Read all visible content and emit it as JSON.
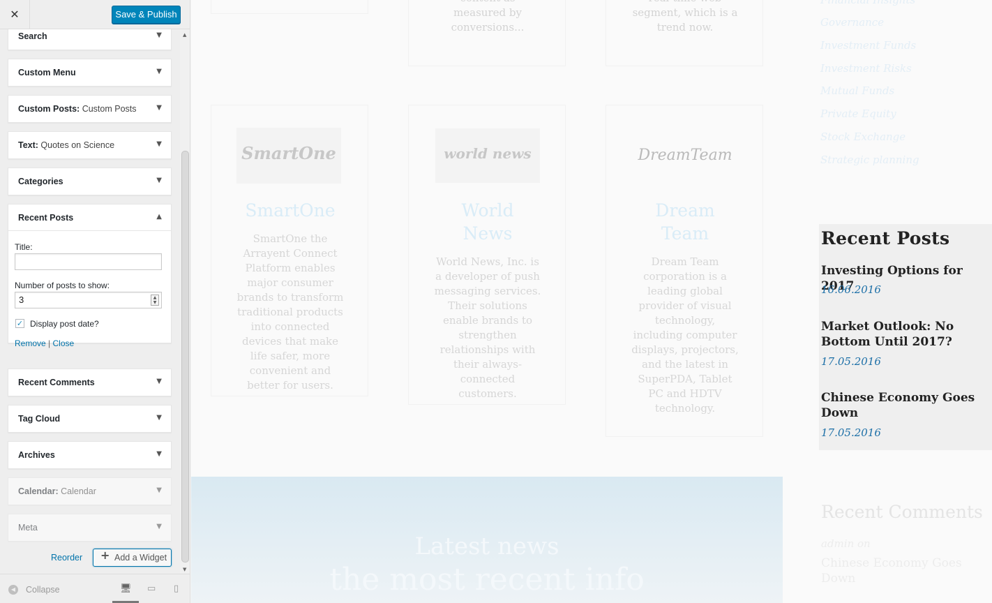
{
  "header": {
    "close_label": "✕",
    "publish_label": "Save & Publish"
  },
  "widgets": [
    {
      "title": "Search",
      "subtitle": "",
      "arrow": "▼"
    },
    {
      "title": "Custom Menu",
      "subtitle": "",
      "arrow": "▼"
    },
    {
      "title": "Custom Posts:",
      "subtitle": "Custom Posts",
      "arrow": "▼"
    },
    {
      "title": "Text:",
      "subtitle": "Quotes on Science",
      "arrow": "▼"
    },
    {
      "title": "Categories",
      "subtitle": "",
      "arrow": "▼"
    },
    {
      "title": "Recent Comments",
      "subtitle": "",
      "arrow": "▼"
    },
    {
      "title": "Tag Cloud",
      "subtitle": "",
      "arrow": "▼"
    },
    {
      "title": "Archives",
      "subtitle": "",
      "arrow": "▼"
    },
    {
      "title": "Calendar:",
      "subtitle": "Calendar",
      "arrow": "▼"
    },
    {
      "title": "Meta",
      "subtitle": "",
      "arrow": "▼"
    }
  ],
  "recent_widget": {
    "title": "Recent Posts",
    "arrow": "▲",
    "title_label": "Title:",
    "title_value": "",
    "num_label": "Number of posts to show:",
    "num_value": "3",
    "spinner_up": "▲",
    "spinner_down": "▼",
    "checkbox_mark": "✓",
    "checkbox_checked": true,
    "checkbox_label": "Display post date?",
    "remove_label": "Remove",
    "separator": "|",
    "close_label": "Close"
  },
  "actions": {
    "reorder_label": "Reorder",
    "add_widget_label": "Add a Widget",
    "add_icon": "+"
  },
  "scrollbar": {
    "up": "▲",
    "down": "▼"
  },
  "footer": {
    "collapse_icon": "◀",
    "collapse_label": "Collapse",
    "desktop_icon": "🖥",
    "tablet_icon": "▭",
    "mobile_icon": "▯"
  },
  "preview": {
    "top_frag_1": "content as\nmeasured by\nconversions...",
    "top_frag_2": "‘real-time web’\nsegment, which is a\ntrend now.",
    "cards": [
      {
        "logo": "SmartOne",
        "title": "SmartOne",
        "desc": "SmartOne the\nArrayent Connect\nPlatform enables\nmajor consumer\nbrands to transform\ntraditional products\ninto connected\ndevices that make\nlife safer, more\nconvenient and\nbetter for users."
      },
      {
        "logo": "world news",
        "title": "World\nNews",
        "desc": "World News, Inc. is\na developer of push\nmessaging services.\nTheir solutions\nenable brands to\nstrengthen\nrelationships with\ntheir always-\nconnected\ncustomers."
      },
      {
        "logo": "DreamTeam",
        "title": "Dream\nTeam",
        "desc": "Dream Team\ncorporation is a\nleading global\nprovider of visual\ntechnology,\nincluding computer\ndisplays, projectors,\nand the latest in\nSuperPDA, Tablet\nPC and HDTV\ntechnology."
      }
    ],
    "news_title": "Latest news",
    "news_subtitle": "the most recent info",
    "categories": [
      "Financial Insights",
      "Governance",
      "Investment Funds",
      "Investment Risks",
      "Mutual Funds",
      "Private Equity",
      "Stock Exchange",
      "Strategic planning"
    ],
    "recent_posts": {
      "heading": "Recent Posts",
      "posts": [
        {
          "title": "Investing Options for 2017",
          "date": "16.06.2016"
        },
        {
          "title": "Market Outlook: No Bottom Until 2017?",
          "date": "17.05.2016"
        },
        {
          "title": "Chinese Economy Goes Down",
          "date": "17.05.2016"
        }
      ]
    },
    "recent_comments": {
      "heading": "Recent Comments",
      "meta": "admin on",
      "link": "Chinese Economy Goes Down"
    }
  },
  "colors": {
    "accent": "#0085ba",
    "link": "#0073aa",
    "date": "#1c6fa7"
  }
}
